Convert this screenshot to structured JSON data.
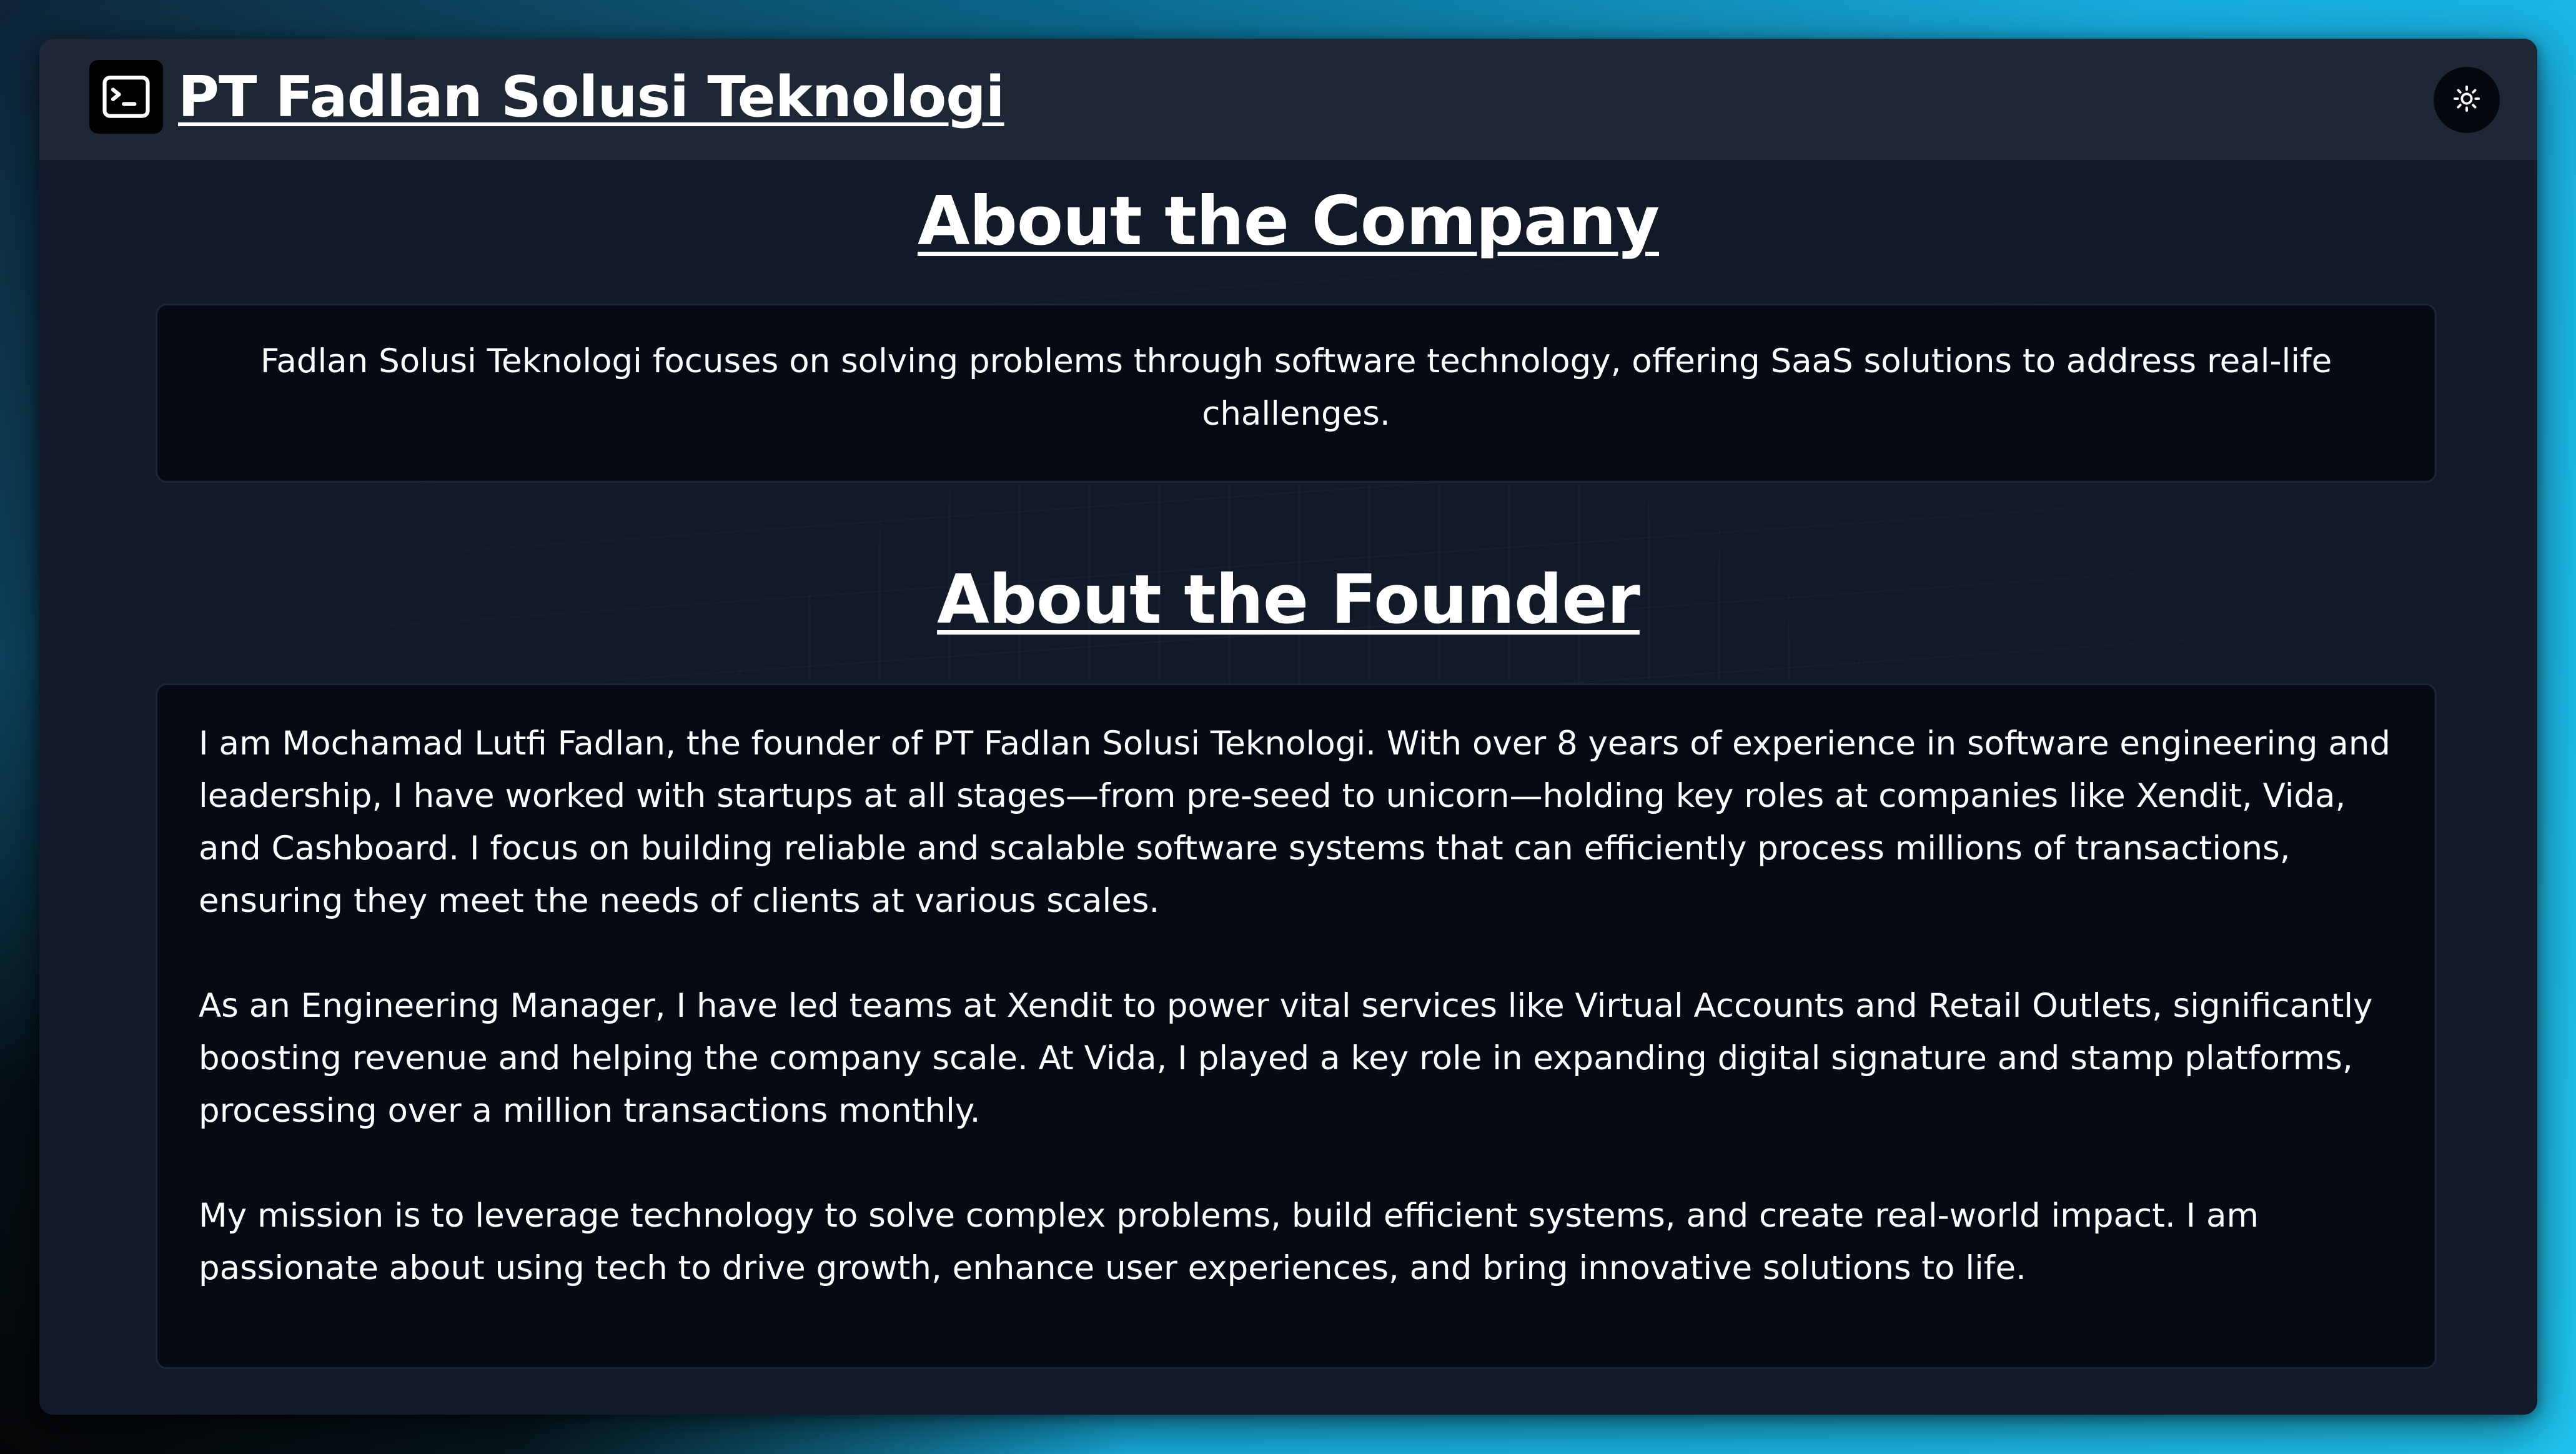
{
  "header": {
    "title": "PT Fadlan Solusi Teknologi",
    "logo_icon": "terminal-icon",
    "theme_toggle_icon": "sun-icon"
  },
  "company": {
    "heading": "About the Company",
    "description": "Fadlan Solusi Teknologi focuses on solving problems through software technology, offering SaaS solutions to address real-life challenges."
  },
  "founder": {
    "heading": "About the Founder",
    "paragraphs": [
      "I am Mochamad Lutfi Fadlan, the founder of PT Fadlan Solusi Teknologi. With over 8 years of experience in software engineering and leadership, I have worked with startups at all stages—from pre-seed to unicorn—holding key roles at companies like Xendit, Vida, and Cashboard. I focus on building reliable and scalable software systems that can efficiently process millions of transactions, ensuring they meet the needs of clients at various scales.",
      "As an Engineering Manager, I have led teams at Xendit to power vital services like Virtual Accounts and Retail Outlets, significantly boosting revenue and helping the company scale. At Vida, I played a key role in expanding digital signature and stamp platforms, processing over a million transactions monthly.",
      "My mission is to leverage technology to solve complex problems, build efficient systems, and create real-world impact. I am passionate about using tech to drive growth, enhance user experiences, and bring innovative solutions to life."
    ]
  },
  "colors": {
    "window_bg": "#121a2a",
    "header_bg": "#1e2736",
    "card_bg": "#050a15",
    "card_border": "#1d2637",
    "text": "#ffffff"
  }
}
